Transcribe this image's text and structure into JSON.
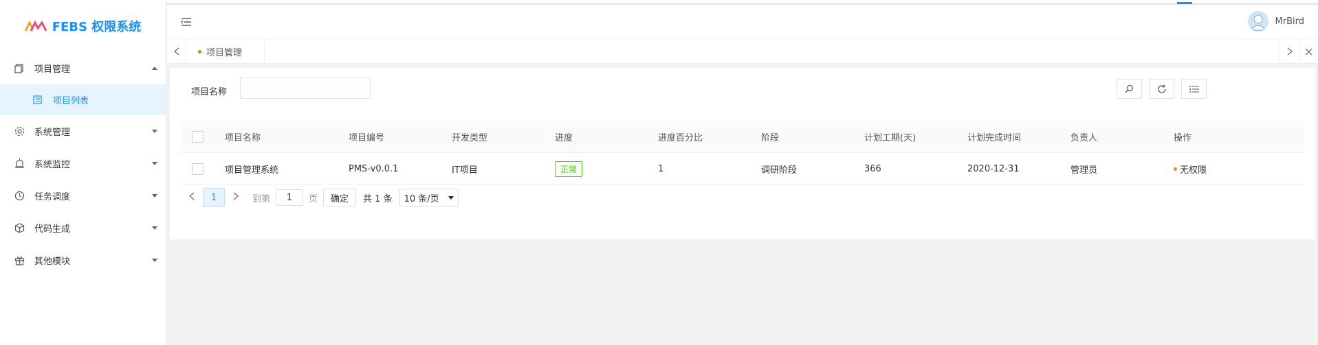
{
  "app": {
    "title": "FEBS 权限系统"
  },
  "sidebar": {
    "items": [
      {
        "label": "项目管理",
        "icon": "copy-icon",
        "expanded": true
      },
      {
        "label": "系统管理",
        "icon": "gear-icon"
      },
      {
        "label": "系统监控",
        "icon": "monitor-icon"
      },
      {
        "label": "任务调度",
        "icon": "clock-icon"
      },
      {
        "label": "代码生成",
        "icon": "cube-icon"
      },
      {
        "label": "其他模块",
        "icon": "gift-icon"
      }
    ],
    "submenu": {
      "label": "项目列表",
      "icon": "list-icon"
    }
  },
  "header": {
    "username": "MrBird"
  },
  "tabs": [
    {
      "label": "项目管理",
      "active": true
    }
  ],
  "search": {
    "label": "项目名称",
    "value": ""
  },
  "table": {
    "headers": [
      "项目名称",
      "项目编号",
      "开发类型",
      "进度",
      "进度百分比",
      "阶段",
      "计划工期(天)",
      "计划完成时间",
      "负责人",
      "操作"
    ],
    "rows": [
      {
        "name": "项目管理系统",
        "code": "PMS-v0.0.1",
        "dev_type": "IT项目",
        "status": "正常",
        "percent": "1",
        "stage": "调研阶段",
        "duration": "366",
        "finish_date": "2020-12-31",
        "owner": "管理员",
        "action": "无权限"
      }
    ]
  },
  "pagination": {
    "current_page": "1",
    "goto_label": "到第",
    "goto_value": "1",
    "page_unit": "页",
    "confirm": "确定",
    "total": "共 1 条",
    "page_size": "10 条/页"
  },
  "colors": {
    "primary": "#1890ff",
    "success": "#52c41a",
    "warning": "#fa8c16"
  }
}
